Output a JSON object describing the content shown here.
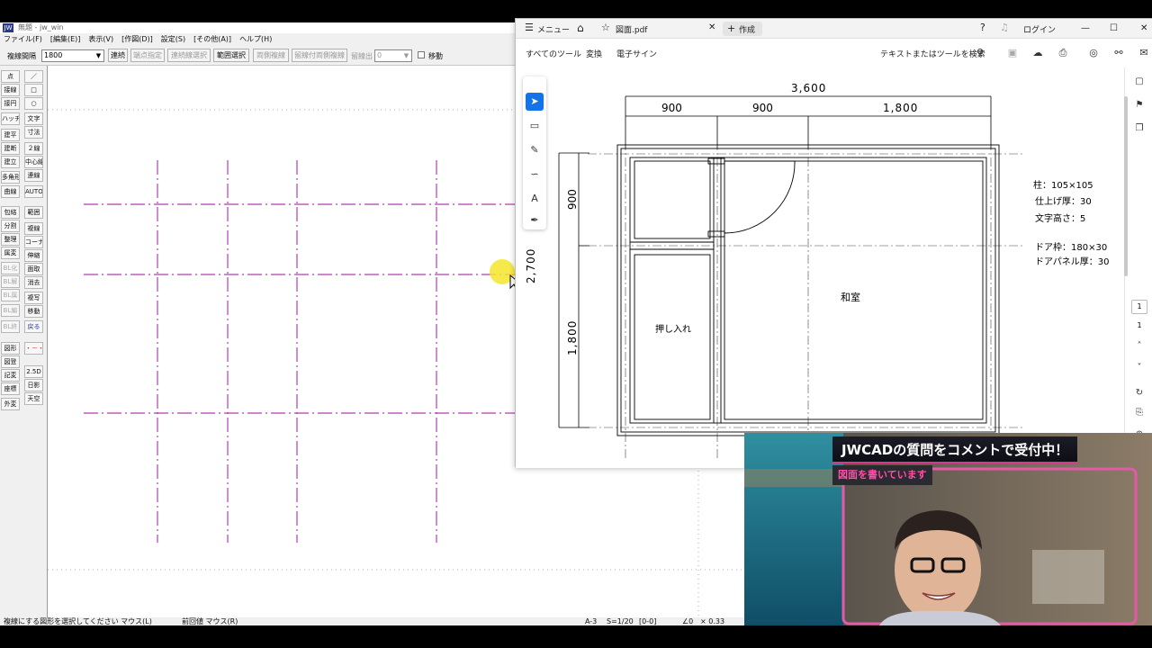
{
  "jw": {
    "title": "無題 - jw_win",
    "logo": "JW",
    "menu": [
      "ファイル(F)",
      "[編集(E)]",
      "表示(V)",
      "[作図(D)]",
      "設定(S)",
      "[その他(A)]",
      "ヘルプ(H)"
    ],
    "toolbar": {
      "label": "複線間隔",
      "value": "1800",
      "buttons": [
        "連続",
        "端点指定",
        "連続線選択",
        "範囲選択",
        "両側複線",
        "留線付両側複線",
        "留線出"
      ],
      "value2": "0",
      "move_label": "移動"
    },
    "side_left": [
      "点",
      "接線",
      "接円",
      "ハッチ",
      "建平",
      "建断",
      "建立",
      "多角形",
      "曲線",
      "包絡",
      "分割",
      "整理",
      "属変",
      "BL化",
      "BL解",
      "BL属",
      "BL編",
      "BL終",
      "図形",
      "図登",
      "記変",
      "座標",
      "外変"
    ],
    "side_right": [
      "／",
      "□",
      "○",
      "文字",
      "寸法",
      "２線",
      "中心線",
      "連線",
      "AUTO",
      "範囲",
      "複線",
      "コーナー",
      "伸縮",
      "面取",
      "消去",
      "複写",
      "移動",
      "戻る",
      "・－・",
      "2.5D",
      "日影",
      "天空"
    ],
    "status": {
      "message": "複線にする図形を選択してください マウス(L)",
      "prev": "前回値 マウス(R)",
      "paper": "A-3",
      "scale": "S=1/20",
      "layer": "[0-0]",
      "angle": "∠0",
      "zoom": "× 0.33"
    }
  },
  "pdf": {
    "menu_label": "メニュー",
    "tab_name": "図面.pdf",
    "create_label": "作成",
    "login_label": "ログイン",
    "tools": [
      "すべてのツール",
      "変換",
      "電子サイン"
    ],
    "search_placeholder": "テキストまたはツールを検索",
    "page_num": "1",
    "page_total": "1",
    "drawing": {
      "dim_total_w": "3,600",
      "dim_w1": "900",
      "dim_w2": "900",
      "dim_w3": "1,800",
      "dim_total_h": "2,700",
      "dim_h1": "900",
      "dim_h2": "1,800",
      "room_label": "和室",
      "closet_label": "押し入れ",
      "notes": [
        "柱：105×105",
        "仕上げ厚：30",
        "文字高さ：5",
        "ドア枠：180×30",
        "ドアパネル厚：30"
      ]
    }
  },
  "stream": {
    "title": "JWCADの質問をコメントで受付中！",
    "subtitle": "図面を書いています"
  },
  "colors": {
    "construction_line": "#b03fb0",
    "accent_blue": "#1473e6",
    "banner_pink": "#ff4fa8"
  }
}
